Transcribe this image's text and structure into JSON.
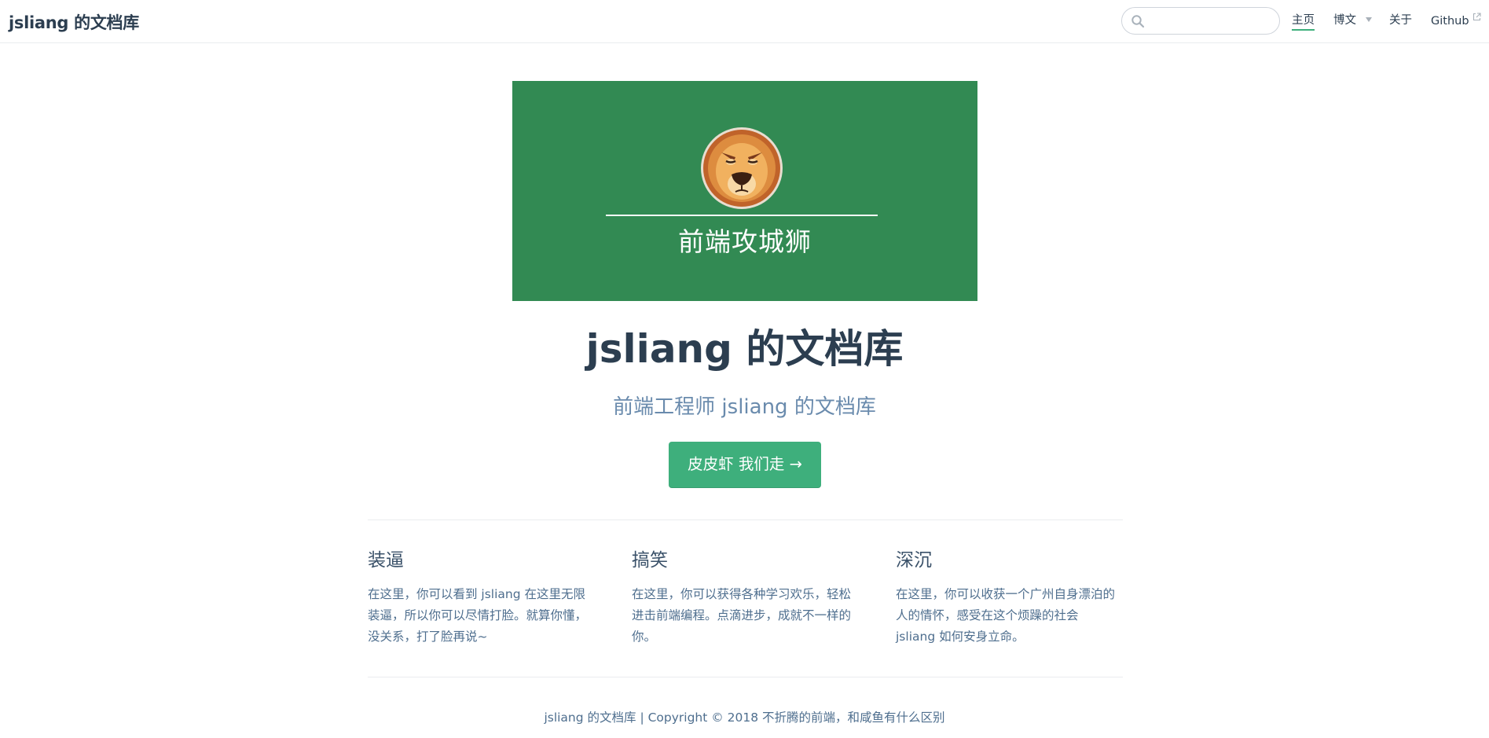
{
  "navbar": {
    "site_name": "jsliang 的文档库",
    "search": {
      "value": "",
      "placeholder": ""
    },
    "links": [
      {
        "label": "主页",
        "active": true
      },
      {
        "label": "博文",
        "has_dropdown": true
      },
      {
        "label": "关于"
      },
      {
        "label": "Github",
        "external": true
      }
    ]
  },
  "hero": {
    "image_caption": "前端攻城狮",
    "image_icon": "lion-icon",
    "title": "jsliang 的文档库",
    "description": "前端工程师 jsliang 的文档库",
    "action_label": "皮皮虾 我们走 →"
  },
  "features": [
    {
      "title": "装逼",
      "lines": [
        "在这里，你可以看到 jsliang 在这里无限",
        "装逼，所以你可以尽情打脸。就算你懂，",
        "没关系，打了脸再说~"
      ]
    },
    {
      "title": "搞笑",
      "lines": [
        "在这里，你可以获得各种学习欢乐，轻松",
        "进击前端编程。点滴进步，成就不一样的",
        "你。"
      ]
    },
    {
      "title": "深沉",
      "lines": [
        "在这里，你可以收获一个广州自身漂泊的",
        "人的情怀，感受在这个烦躁的社会",
        "jsliang 如何安身立命。"
      ]
    }
  ],
  "footer": {
    "text": "jsliang 的文档库 | Copyright © 2018 不折腾的前端，和咸鱼有什么区别"
  },
  "colors": {
    "accent": "#3eaf7c",
    "hero_bg": "#328a53",
    "text": "#2c3e50",
    "muted": "#6a8bad"
  }
}
